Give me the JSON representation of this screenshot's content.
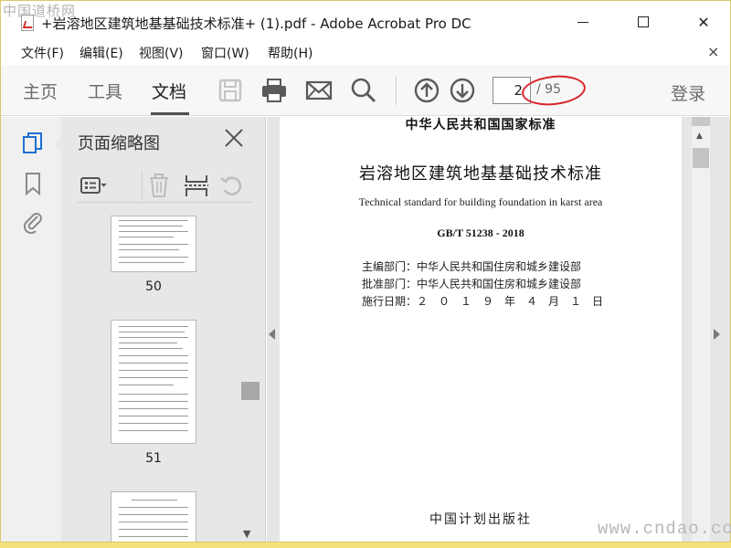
{
  "watermark_top": "中国道桥网",
  "watermark_bottom": "www.cndao.com",
  "window": {
    "title": "+岩溶地区建筑地基基础技术标准+ (1).pdf - Adobe Acrobat Pro DC",
    "minimize": "—",
    "close": "✕"
  },
  "menu": {
    "items": [
      "文件(F)",
      "编辑(E)",
      "视图(V)",
      "窗口(W)",
      "帮助(H)"
    ],
    "close": "×"
  },
  "toolbar": {
    "tabs": [
      "主页",
      "工具",
      "文档"
    ],
    "active_tab": "文档",
    "page_current": "2",
    "page_total": "/ 95",
    "login": "登录"
  },
  "thumbnails": {
    "title": "页面缩略图",
    "pages": [
      "50",
      "51"
    ]
  },
  "document": {
    "header": "中华人民共和国国家标准",
    "title": "岩溶地区建筑地基基础技术标准",
    "subtitle": "Technical standard for building foundation in karst area",
    "code": "GB/T 51238 - 2018",
    "lines": [
      "主编部门：中华人民共和国住房和城乡建设部",
      "批准部门：中华人民共和国住房和城乡建设部",
      "施行日期：２　０　１　９　年　４　月　１　日"
    ],
    "publisher": "中国计划出版社"
  },
  "colors": {
    "annotation_ellipse": "#d8242a",
    "outer_border": "#f3e27a"
  }
}
